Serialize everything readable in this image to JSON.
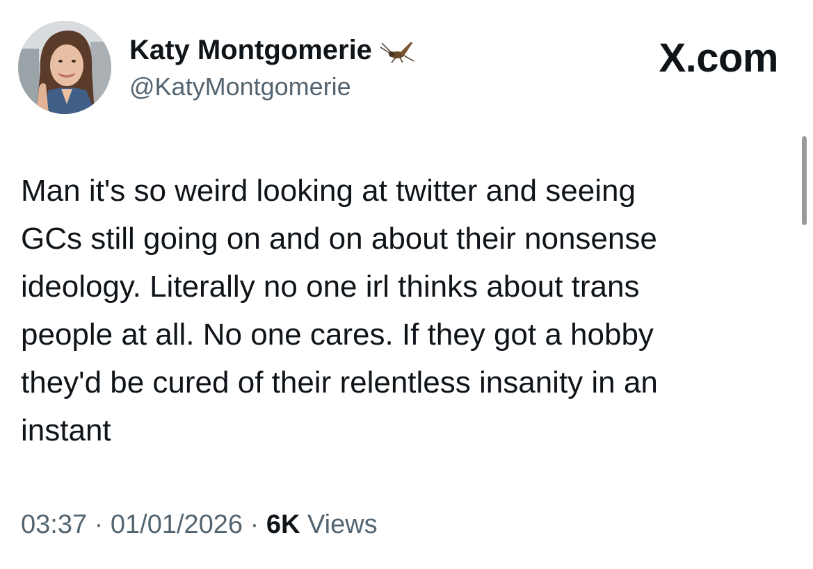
{
  "tweet": {
    "author": {
      "display_name": "Katy Montgomerie",
      "handle": "@KatyMontgomerie",
      "name_emoji": "cricket-icon"
    },
    "brand": "X.com",
    "text": "Man it's so weird looking at twitter and seeing\nGCs still going on and on about their nonsense\nideology. Literally no one irl thinks about trans\npeople at all. No one cares. If they got a hobby\nthey'd be cured of their relentless insanity in an\ninstant",
    "meta": {
      "time": "03:37",
      "separator": "·",
      "date": "01/01/2026",
      "views_count": "6K",
      "views_label": "Views"
    }
  }
}
